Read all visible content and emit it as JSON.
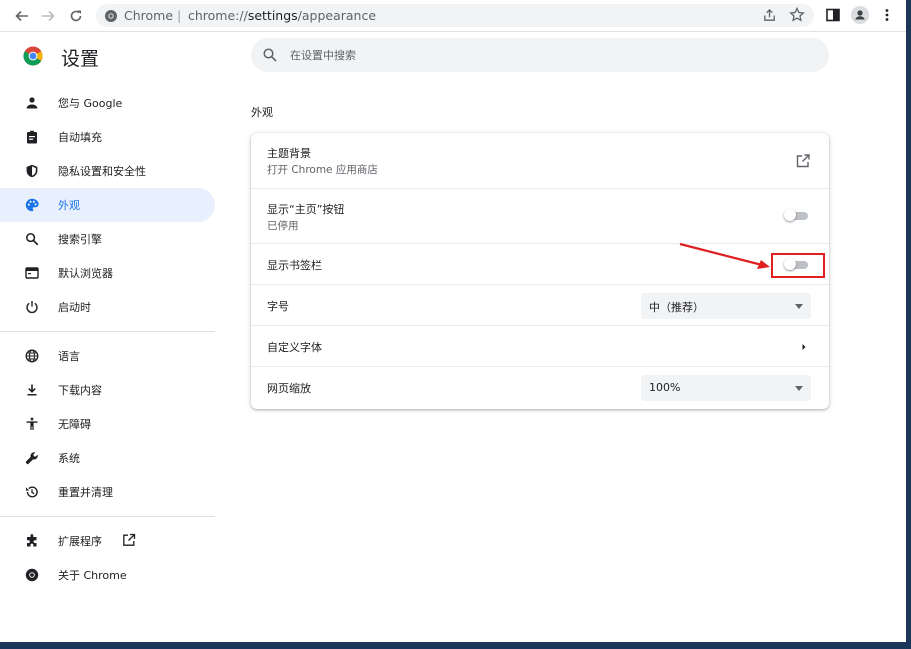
{
  "browser": {
    "omnibox": {
      "site_label": "Chrome",
      "separator": "|",
      "url_prefix": "chrome://",
      "url_host": "settings",
      "url_path": "/appearance"
    }
  },
  "sidebar": {
    "title": "设置",
    "items": [
      {
        "label": "您与 Google",
        "icon": "person-icon"
      },
      {
        "label": "自动填充",
        "icon": "clipboard-icon"
      },
      {
        "label": "隐私设置和安全性",
        "icon": "shield-icon"
      },
      {
        "label": "外观",
        "icon": "palette-icon",
        "active": true
      },
      {
        "label": "搜索引擎",
        "icon": "search-icon"
      },
      {
        "label": "默认浏览器",
        "icon": "browser-icon"
      },
      {
        "label": "启动时",
        "icon": "power-icon"
      },
      {
        "label": "语言",
        "icon": "globe-icon"
      },
      {
        "label": "下载内容",
        "icon": "download-icon"
      },
      {
        "label": "无障碍",
        "icon": "accessibility-icon"
      },
      {
        "label": "系统",
        "icon": "wrench-icon"
      },
      {
        "label": "重置并清理",
        "icon": "history-icon"
      },
      {
        "label": "扩展程序",
        "icon": "puzzle-icon"
      },
      {
        "label": "关于 Chrome",
        "icon": "chrome-icon"
      }
    ]
  },
  "search": {
    "placeholder": "在设置中搜索"
  },
  "section": {
    "title": "外观"
  },
  "rows": {
    "theme": {
      "label": "主题背景",
      "sub": "打开 Chrome 应用商店"
    },
    "home": {
      "label": "显示“主页”按钮",
      "sub": "已停用",
      "enabled": false
    },
    "bookmarks": {
      "label": "显示书签栏",
      "enabled": false
    },
    "font_size": {
      "label": "字号",
      "value": "中（推荐）"
    },
    "custom_fonts": {
      "label": "自定义字体"
    },
    "zoom": {
      "label": "网页缩放",
      "value": "100%"
    }
  },
  "colors": {
    "accent": "#1a73e8",
    "active_bg": "#e8f0fe",
    "annotation": "#e02020"
  }
}
